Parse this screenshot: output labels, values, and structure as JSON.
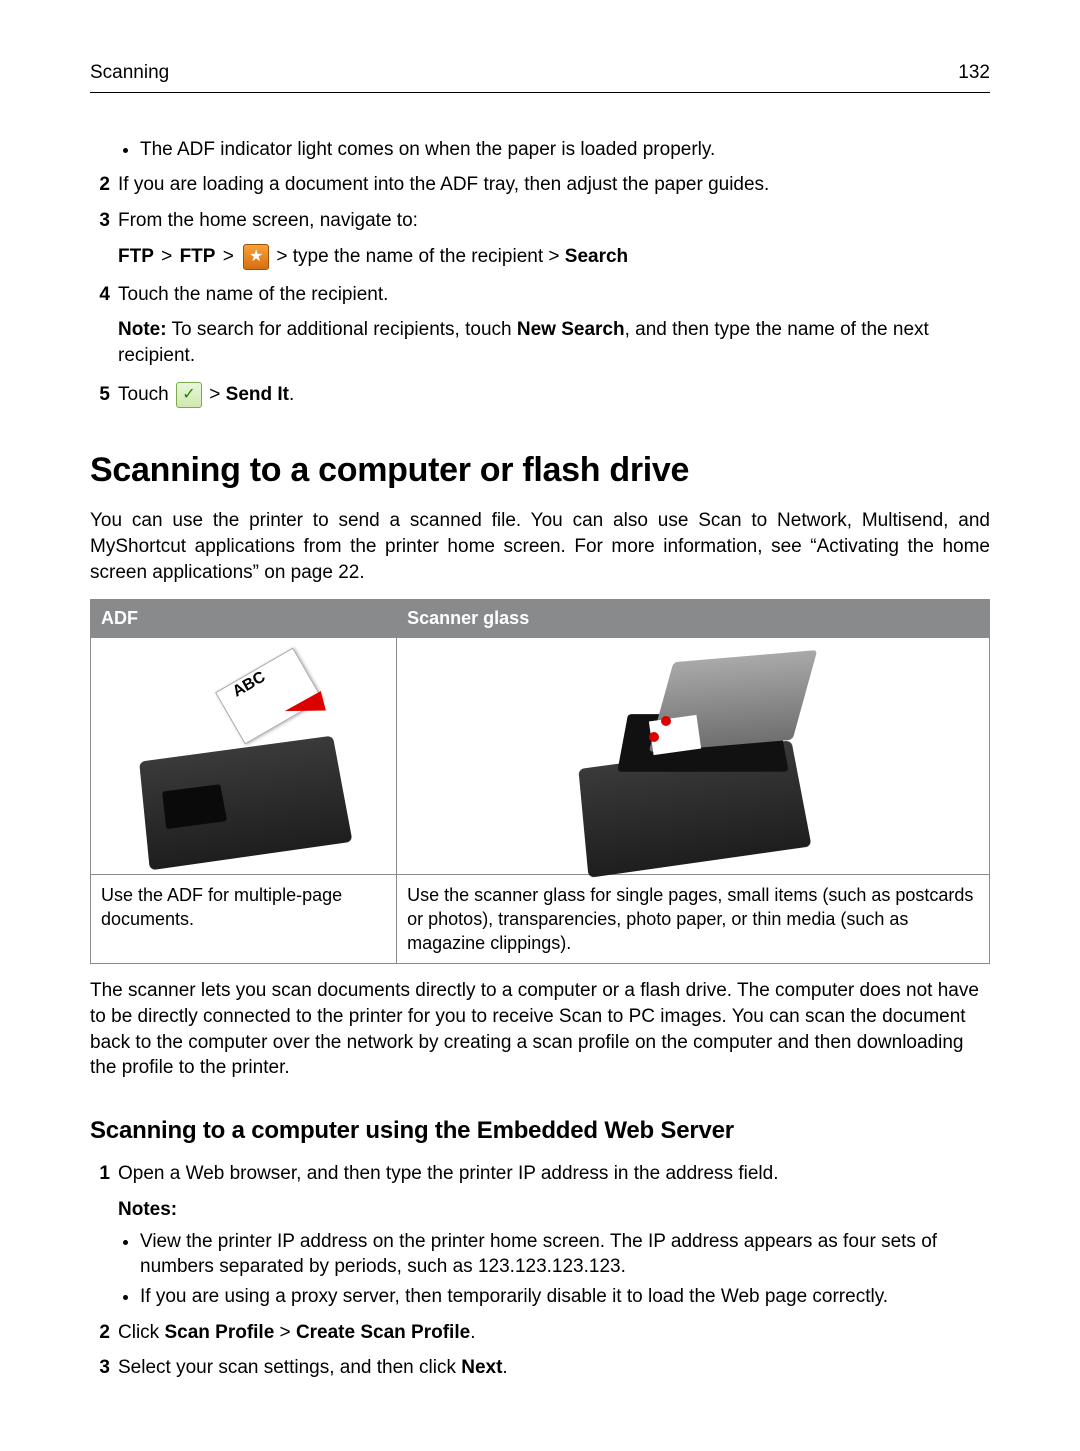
{
  "running_head": {
    "section": "Scanning",
    "page": "132"
  },
  "top_bullet": "The ADF indicator light comes on when the paper is loaded properly.",
  "steps_top": {
    "s2": {
      "num": "2",
      "text": "If you are loading a document into the ADF tray, then adjust the paper guides."
    },
    "s3": {
      "num": "3",
      "text": "From the home screen, navigate to:",
      "navpath": {
        "a": "FTP",
        "sep1": ">",
        "b": "FTP",
        "sep2": ">",
        "icon": "search-icon",
        "mid": " > type the name of the recipient > ",
        "c": "Search"
      }
    },
    "s4": {
      "num": "4",
      "text": "Touch the name of the recipient.",
      "note_label": "Note:",
      "note_body_a": " To search for additional recipients, touch ",
      "note_bold": "New Search",
      "note_body_b": ", and then type the name of the next recipient."
    },
    "s5": {
      "num": "5",
      "lead": "Touch ",
      "sep": " > ",
      "bold": "Send It",
      "tail": "."
    }
  },
  "section_heading": "Scanning to a computer or flash drive",
  "section_para": "You can use the printer to send a scanned file. You can also use Scan to Network, Multisend, and MyShortcut applications from the printer home screen. For more information, see “Activating the home screen applications” on page 22.",
  "table": {
    "th1": "ADF",
    "th2": "Scanner glass",
    "desc1": "Use the ADF for multiple‑page documents.",
    "desc2": "Use the scanner glass for single pages, small items (such as postcards or photos), transparencies, photo paper, or thin media (such as magazine clippings)."
  },
  "after_table_para": "The scanner lets you scan documents directly to a computer or a flash drive. The computer does not have to be directly connected to the printer for you to receive Scan to PC images. You can scan the document back to the computer over the network by creating a scan profile on the computer and then downloading the profile to the printer.",
  "subheading": "Scanning to a computer using the Embedded Web Server",
  "steps_bottom": {
    "s1": {
      "num": "1",
      "text": "Open a Web browser, and then type the printer IP address in the address field.",
      "notes_label": "Notes:",
      "b1": "View the printer IP address on the printer home screen. The IP address appears as four sets of numbers separated by periods, such as 123.123.123.123.",
      "b2": "If you are using a proxy server, then temporarily disable it to load the Web page correctly."
    },
    "s2": {
      "num": "2",
      "lead": "Click ",
      "bold1": "Scan Profile",
      "sep": " > ",
      "bold2": "Create Scan Profile",
      "tail": "."
    },
    "s3": {
      "num": "3",
      "lead": "Select your scan settings, and then click ",
      "bold": "Next",
      "tail": "."
    }
  },
  "icons": {
    "adf_abc": "ABC",
    "check": "✓",
    "person": "★"
  }
}
